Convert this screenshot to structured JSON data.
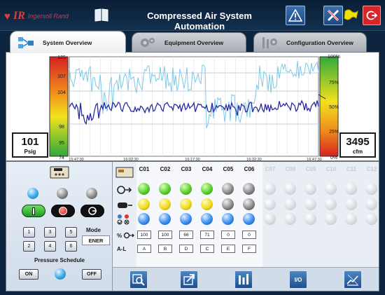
{
  "header": {
    "brand_mark": "IR",
    "brand_name": "Ingersoll Rand",
    "title": "Compressed Air System Automation",
    "icons": [
      "book-icon",
      "warning-icon",
      "tools-icon",
      "flag-icon",
      "exit-icon"
    ]
  },
  "tabs": [
    {
      "label": "System Overview",
      "icon": "system-overview-icon",
      "active": true
    },
    {
      "label": "Equipment Overview",
      "icon": "gears-icon",
      "active": false
    },
    {
      "label": "Configuration Overview",
      "icon": "configuration-icon",
      "active": false
    }
  ],
  "trend": {
    "pressure_ticks": [
      "125",
      "107",
      "104",
      "98",
      "95",
      "74"
    ],
    "percent_ticks": [
      "100%",
      "75%",
      "50%",
      "25%",
      "0%"
    ],
    "time_ticks": [
      "15:47:30",
      "16:02:30",
      "16:17:30",
      "16:32:30",
      "16:47:30"
    ],
    "pressure_readout": {
      "value": "101",
      "unit": "Psig"
    },
    "flow_readout": {
      "value": "3495",
      "unit": "cfm"
    },
    "colors": {
      "pressure": "#2a2aa0",
      "flow": "#7ec8e8"
    }
  },
  "controls": {
    "mode_label": "Mode",
    "mode_value": "ENER",
    "keys": [
      "1",
      "3",
      "5",
      "2",
      "4",
      "6"
    ],
    "schedule_label": "Pressure Schedule",
    "schedule_on": "ON",
    "schedule_off": "OFF"
  },
  "compressors": {
    "active_columns": [
      "C01",
      "C02",
      "C03",
      "C04",
      "C05",
      "C06"
    ],
    "inactive_columns": [
      "C07",
      "C08",
      "C09",
      "C10",
      "C11",
      "C12"
    ],
    "row_status": [
      "green",
      "green",
      "green",
      "green",
      "gray",
      "gray"
    ],
    "row_load": [
      "yellow",
      "yellow",
      "yellow",
      "yellow",
      "gray",
      "gray"
    ],
    "row_select": [
      "blue",
      "blue",
      "blue",
      "blue",
      "blue",
      "blue"
    ],
    "percent_values": [
      "100",
      "100",
      "66",
      "71",
      "0",
      "0"
    ],
    "sequence": [
      "A",
      "B",
      "D",
      "C",
      "E",
      "F"
    ],
    "row_labels": {
      "percent": "%",
      "sequence": "A-L"
    }
  },
  "nav": {
    "io_label": "I/O",
    "icons": [
      "search-icon",
      "export-icon",
      "bar-chart-icon",
      "io-icon",
      "trend-edit-icon"
    ]
  }
}
